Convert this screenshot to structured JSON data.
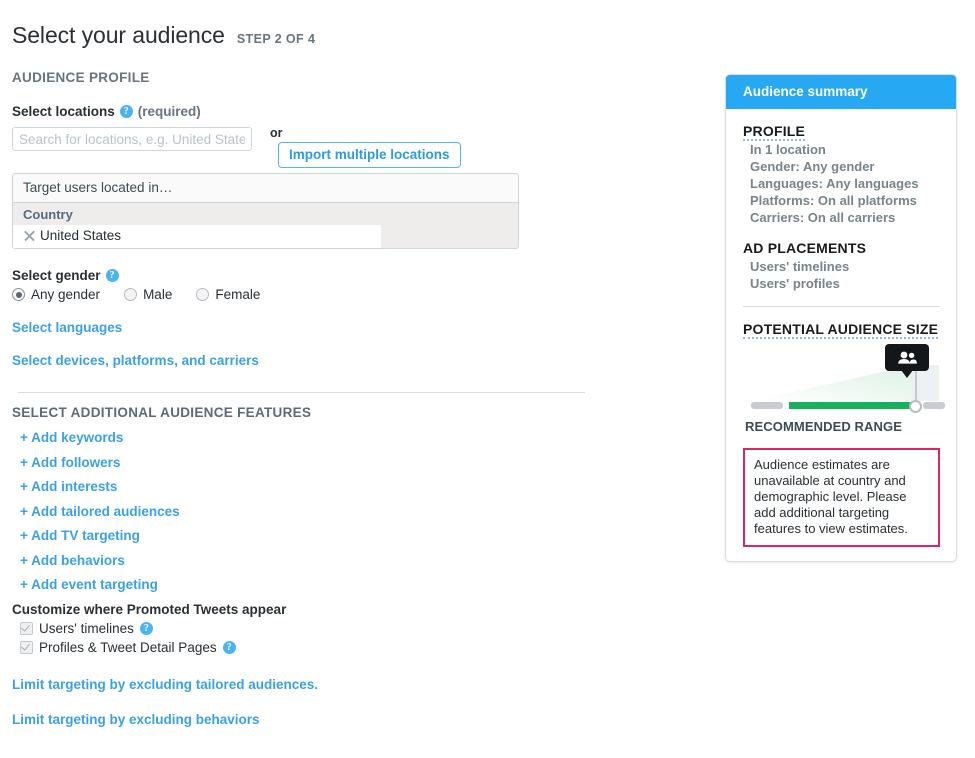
{
  "page": {
    "title": "Select your audience",
    "step_label": "STEP 2 OF 4",
    "section_profile": "AUDIENCE PROFILE"
  },
  "locations": {
    "label": "Select locations",
    "required_note": "(required)",
    "help_icon": "help-icon",
    "input_placeholder": "Search for locations, e.g. United States",
    "input_value": "",
    "or_text": "or",
    "import_button": "Import multiple locations",
    "table_caption": "Target users located in…",
    "column_header": "Country",
    "rows": [
      {
        "name": "United States",
        "remove_icon": "close-x-icon"
      }
    ]
  },
  "gender": {
    "label": "Select gender",
    "help_icon": "help-icon",
    "options": [
      {
        "label": "Any gender",
        "selected": true
      },
      {
        "label": "Male",
        "selected": false
      },
      {
        "label": "Female",
        "selected": false
      }
    ]
  },
  "links": {
    "languages": "Select languages",
    "devices": "Select devices, platforms, and carriers"
  },
  "features": {
    "heading": "SELECT ADDITIONAL AUDIENCE FEATURES",
    "items": [
      "+ Add keywords",
      "+ Add followers",
      "+ Add interests",
      "+ Add tailored audiences",
      "+ Add TV targeting",
      "+ Add behaviors",
      "+ Add event targeting"
    ]
  },
  "placements": {
    "heading": "Customize where Promoted Tweets appear",
    "items": [
      {
        "label": "Users' timelines",
        "checked": true,
        "help_icon": "help-icon"
      },
      {
        "label": "Profiles & Tweet Detail Pages",
        "checked": true,
        "help_icon": "help-icon"
      }
    ]
  },
  "limit_links": [
    "Limit targeting by excluding tailored audiences.",
    "Limit targeting by excluding behaviors"
  ],
  "summary": {
    "header": "Audience summary",
    "profile_heading": "PROFILE",
    "profile_lines": [
      "In 1 location",
      "Gender: Any gender",
      "Languages: Any languages",
      "Platforms: On all platforms",
      "Carriers: On all carriers"
    ],
    "placements_heading": "AD PLACEMENTS",
    "placements_lines": [
      "Users' timelines",
      "Users' profiles"
    ],
    "size_heading": "POTENTIAL AUDIENCE SIZE",
    "recommended_range": "RECOMMENDED RANGE",
    "tooltip_icon": "people-icon",
    "warning": "Audience estimates are unavailable at country and demographic level. Please add additional targeting features to view estimates."
  },
  "colors": {
    "brand_blue": "#26a8f2",
    "link_blue": "#3aa1e8",
    "warning_pink": "#e0245e",
    "slider_green": "#17b05d",
    "muted_gray": "#66757f"
  }
}
